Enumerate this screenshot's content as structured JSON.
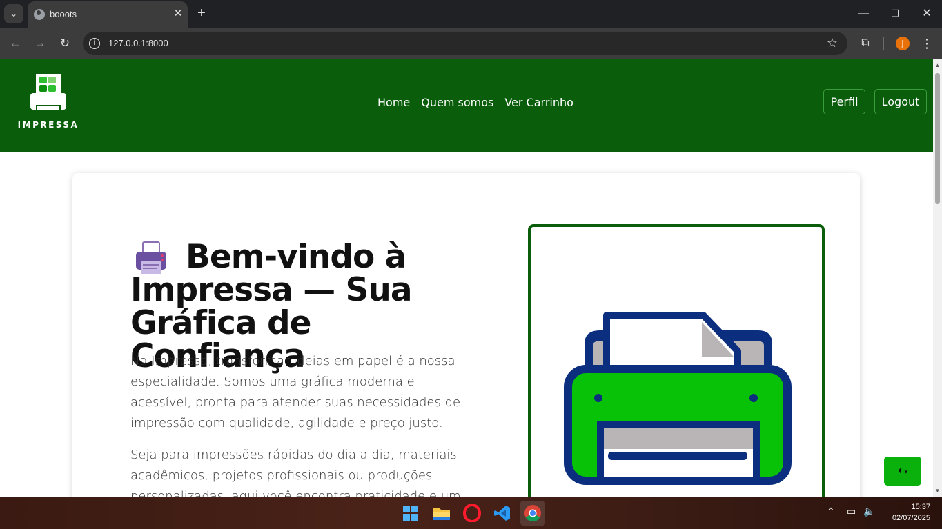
{
  "browser": {
    "tab_title": "booots",
    "url": "127.0.0.1:8000",
    "avatar_letter": "j",
    "icons": [
      "tab-search-icon",
      "globe-icon",
      "close-icon",
      "plus-icon",
      "minimize-icon",
      "restore-icon",
      "close-window-icon",
      "back-icon",
      "forward-icon",
      "reload-icon",
      "info-icon",
      "star-icon",
      "extensions-icon",
      "menu-icon"
    ]
  },
  "header": {
    "logo_text": "IMPRESSA",
    "nav": [
      "Home",
      "Quem somos",
      "Ver Carrinho"
    ],
    "profile_label": "Perfil",
    "logout_label": "Logout",
    "bg_color": "#0a5e0b"
  },
  "hero": {
    "title": "Bem-vindo à Impressa — Sua Gráfica de Confiança",
    "paragraph1": "Na Impressa, transformar ideias em papel é a nossa especialidade. Somos uma gráfica moderna e acessível, pronta para atender suas necessidades de impressão com qualidade, agilidade e preço justo.",
    "paragraph2": "Seja para impressões rápidas do dia a dia, materiais acadêmicos, projetos profissionais ou produções personalizadas, aqui você encontra praticidade e um"
  },
  "theme_toggle": {
    "icon": "contrast-icon"
  },
  "taskbar": {
    "apps": [
      "windows-start-icon",
      "file-explorer-icon",
      "opera-icon",
      "vscode-icon",
      "chrome-icon"
    ],
    "time": "15:37",
    "date": "02/07/2025"
  }
}
